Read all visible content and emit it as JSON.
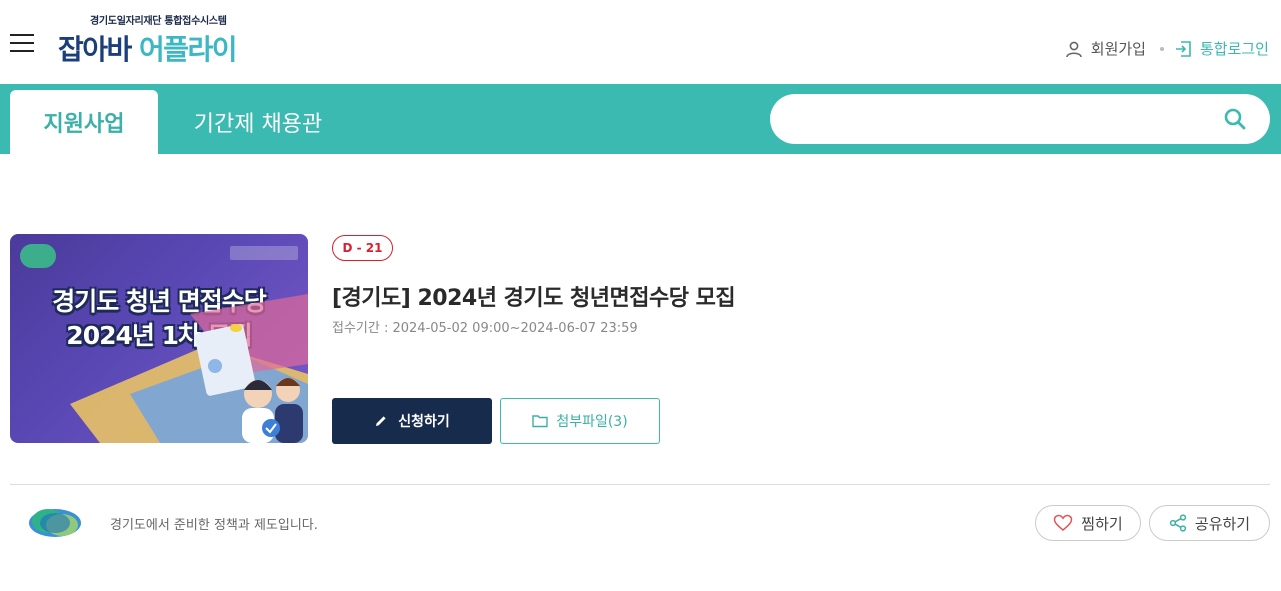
{
  "header": {
    "logo_sub": "경기도일자리재단 통합접수시스템",
    "logo_part1": "잡아바",
    "logo_part2": "어플라이",
    "signup_label": "회원가입",
    "login_label": "통합로그인"
  },
  "nav": {
    "tabs": [
      {
        "label": "지원사업",
        "active": true
      },
      {
        "label": "기간제 채용관",
        "active": false
      }
    ],
    "search_placeholder": ""
  },
  "program": {
    "thumbnail": {
      "line1": "경기도 청년 면접수당",
      "line2": "2024년 1차 모집"
    },
    "dday": "D - 21",
    "title": "[경기도] 2024년 경기도 청년면접수당 모집",
    "period": "접수기간 : 2024-05-02 09:00~2024-06-07 23:59",
    "apply_label": "신청하기",
    "attach_label": "첨부파일(3)"
  },
  "footer": {
    "org_text": "경기도에서 준비한 정책과 제도입니다.",
    "favorite_label": "찜하기",
    "share_label": "공유하기"
  },
  "colors": {
    "accent": "#3bbab2",
    "navy": "#172b4d",
    "dday_red": "#d8202e"
  },
  "icons": [
    "menu-icon",
    "user-icon",
    "login-icon",
    "search-icon",
    "pencil-icon",
    "folder-icon",
    "heart-icon",
    "share-icon"
  ]
}
